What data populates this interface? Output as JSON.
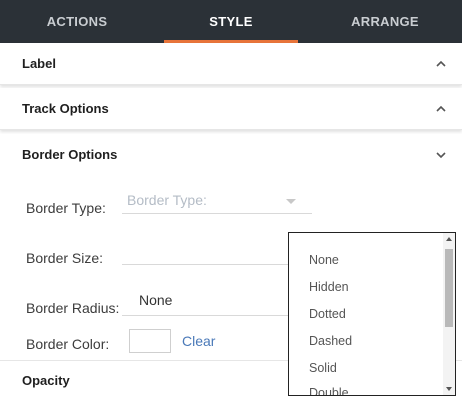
{
  "tabs": [
    {
      "label": "ACTIONS"
    },
    {
      "label": "STYLE"
    },
    {
      "label": "ARRANGE"
    }
  ],
  "sections": {
    "label": {
      "title": "Label",
      "state": "collapsed"
    },
    "track_options": {
      "title": "Track Options",
      "state": "collapsed"
    },
    "border_options": {
      "title": "Border Options",
      "state": "expanded"
    },
    "opacity": {
      "title": "Opacity"
    }
  },
  "border": {
    "type_label": "Border Type:",
    "type_placeholder": "Border Type:",
    "size_label": "Border Size:",
    "radius_label": "Border Radius:",
    "radius_value": "None",
    "color_label": "Border Color:",
    "clear_label": "Clear"
  },
  "dropdown": {
    "options": [
      "None",
      "Hidden",
      "Dotted",
      "Dashed",
      "Solid",
      "Double"
    ]
  },
  "icons": {
    "collapsed": "chevron-up-icon",
    "expanded": "chevron-down-icon"
  },
  "colors": {
    "tab_bar": "#2b3137",
    "accent": "#e8743a",
    "link": "#4a79b8"
  }
}
